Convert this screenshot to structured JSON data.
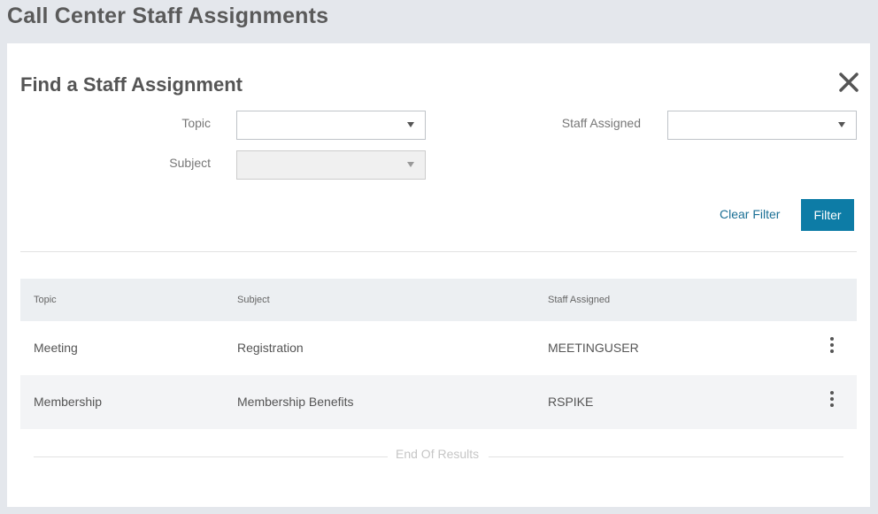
{
  "page": {
    "title": "Call Center Staff Assignments"
  },
  "panel": {
    "title": "Find a Staff Assignment",
    "close_icon": "close-icon"
  },
  "filters": {
    "topic_label": "Topic",
    "topic_value": "",
    "staff_label": "Staff Assigned",
    "staff_value": "",
    "subject_label": "Subject",
    "subject_value": "",
    "clear_label": "Clear Filter",
    "filter_label": "Filter"
  },
  "table": {
    "columns": [
      "Topic",
      "Subject",
      "Staff Assigned"
    ],
    "rows": [
      {
        "topic": "Meeting",
        "subject": "Registration",
        "staff": "MEETINGUSER"
      },
      {
        "topic": "Membership",
        "subject": "Membership Benefits",
        "staff": "RSPIKE"
      }
    ],
    "end_text": "End Of Results"
  },
  "colors": {
    "accent": "#0d7ca6",
    "link": "#1a6f95",
    "background": "#e4e7ec"
  }
}
